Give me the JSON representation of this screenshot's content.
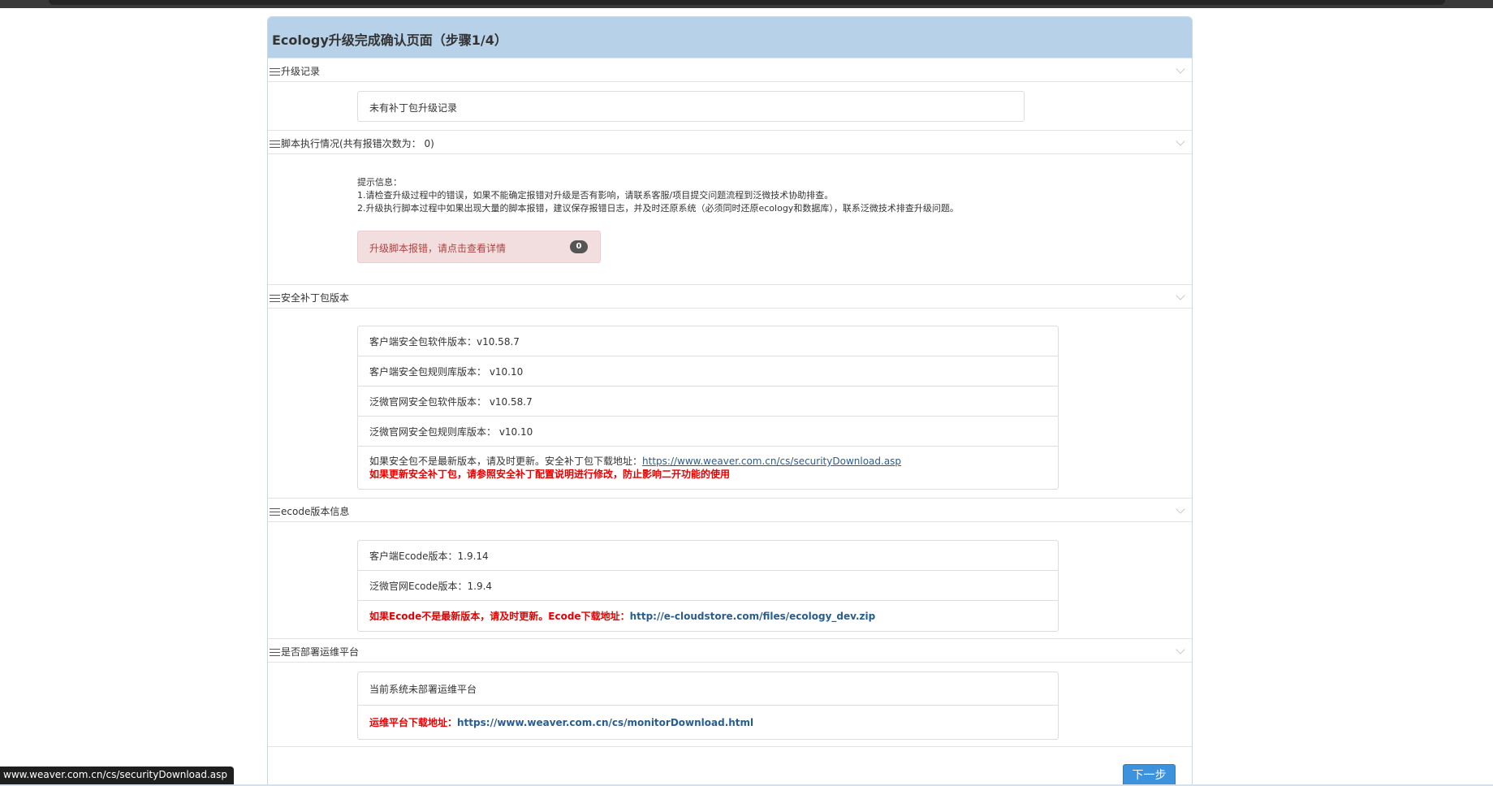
{
  "panel": {
    "title": "Ecology升级完成确认页面（步骤1/4）"
  },
  "sections": {
    "upgrade_record": {
      "header": "升级记录",
      "content": "未有补丁包升级记录"
    },
    "script_execution": {
      "header": "脚本执行情况(共有报错次数为： 0)",
      "tips": [
        "提示信息：",
        "1.请检查升级过程中的错误，如果不能确定报错对升级是否有影响，请联系客服/项目提交问题流程到泛微技术协助排查。",
        "2.升级执行脚本过程中如果出现大量的脚本报错，建议保存报错日志，并及时还原系统（必须同时还原ecology和数据库），联系泛微技术排查升级问题。"
      ],
      "alert_label": "升级脚本报错，请点击查看详情",
      "error_count": "0"
    },
    "security_patch": {
      "header": "安全补丁包版本",
      "rows": [
        "客户端安全包软件版本：v10.58.7",
        "客户端安全包规则库版本： v10.10",
        "泛微官网安全包软件版本： v10.58.7",
        "泛微官网安全包规则库版本： v10.10"
      ],
      "notice_prefix": "如果安全包不是最新版本，请及时更新。安全补丁包下载地址：",
      "notice_link": "https://www.weaver.com.cn/cs/securityDownload.asp",
      "warning": "如果更新安全补丁包，请参照安全补丁配置说明进行修改，防止影响二开功能的使用"
    },
    "ecode": {
      "header": "ecode版本信息",
      "rows": [
        "客户端Ecode版本：1.9.14",
        "泛微官网Ecode版本：1.9.4"
      ],
      "notice_prefix": "如果Ecode不是最新版本，请及时更新。Ecode下载地址：",
      "notice_link": "http://e-cloudstore.com/files/ecology_dev.zip"
    },
    "ops_platform": {
      "header": "是否部署运维平台",
      "status": "当前系统未部署运维平台",
      "download_prefix": "运维平台下载地址：",
      "download_link": "https://www.weaver.com.cn/cs/monitorDownload.html"
    }
  },
  "next_button": "下一步",
  "status_bar": "www.weaver.com.cn/cs/securityDownload.asp"
}
